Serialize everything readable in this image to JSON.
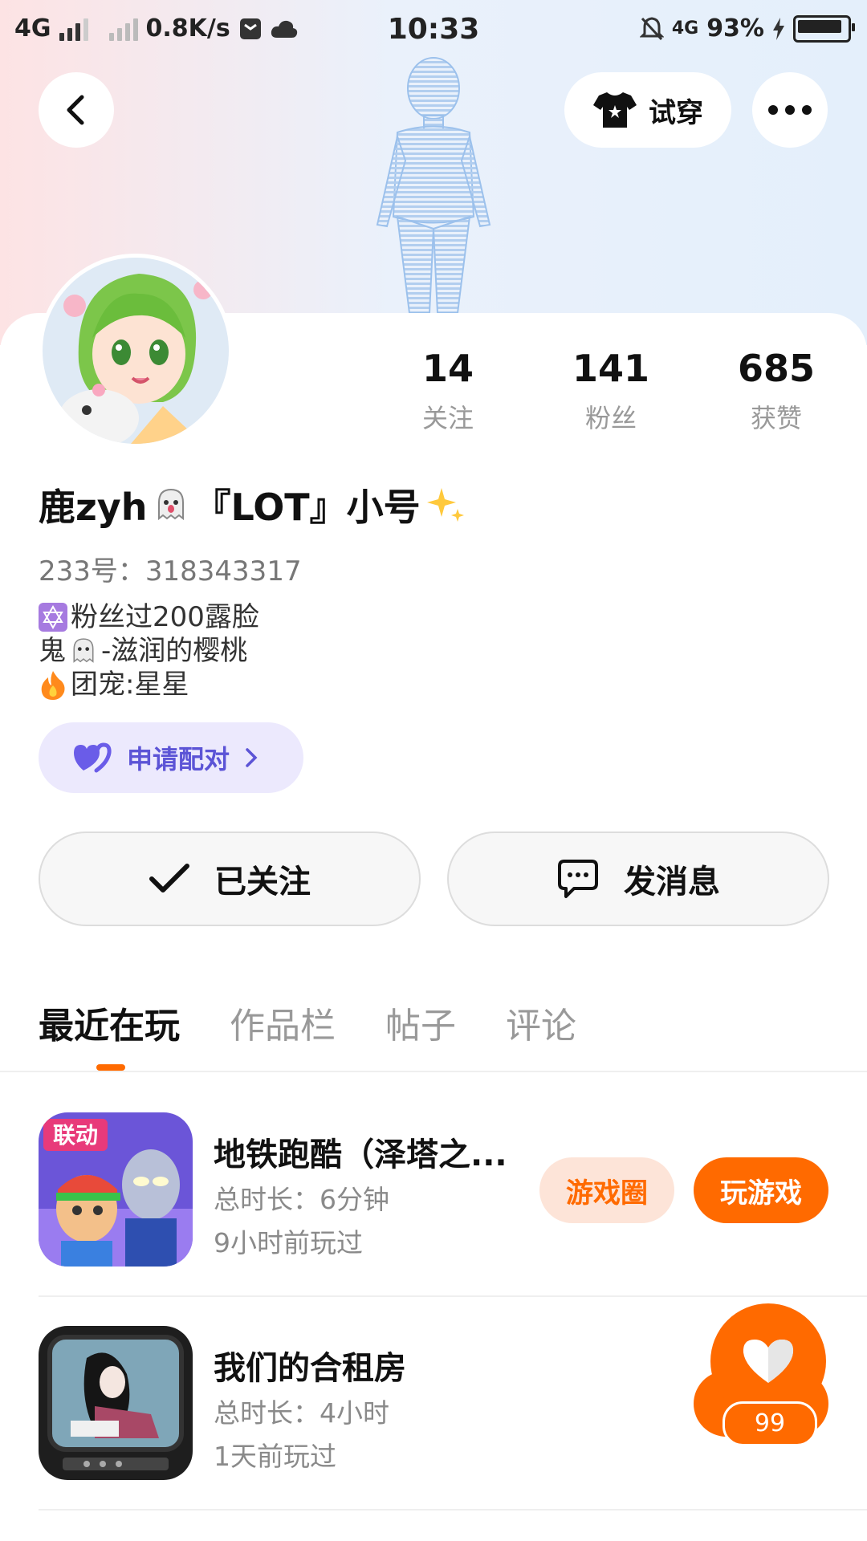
{
  "status_bar": {
    "network_left": "4G",
    "speed": "0.8K/s",
    "time": "10:33",
    "network_right": "4G",
    "battery": "93%"
  },
  "header": {
    "tryon_label": "试穿"
  },
  "profile": {
    "stats": [
      {
        "value": "14",
        "label": "关注"
      },
      {
        "value": "141",
        "label": "粉丝"
      },
      {
        "value": "685",
        "label": "获赞"
      }
    ],
    "name": "鹿zyh",
    "name_suffix": "『LOT』小号",
    "uid": "233号：318343317",
    "bio": [
      "粉丝过200露脸",
      "鬼",
      "-滋润的樱桃",
      "团宠:星星"
    ],
    "pair_label": "申请配对"
  },
  "actions": {
    "followed": "已关注",
    "message": "发消息"
  },
  "tabs": [
    "最近在玩",
    "作品栏",
    "帖子",
    "评论"
  ],
  "games": [
    {
      "title": "地铁跑酷（泽塔之...",
      "duration": "总时长：6分钟",
      "last_played": "9小时前玩过",
      "circle_label": "游戏圈",
      "play_label": "玩游戏",
      "icon_badge": "联动"
    },
    {
      "title": "我们的合租房",
      "duration": "总时长：4小时",
      "last_played": "1天前玩过"
    }
  ],
  "float": {
    "badge": "99"
  },
  "colors": {
    "accent": "#ff6a00",
    "pair_bg": "#ece9fd",
    "pair_text": "#5c54d6"
  }
}
